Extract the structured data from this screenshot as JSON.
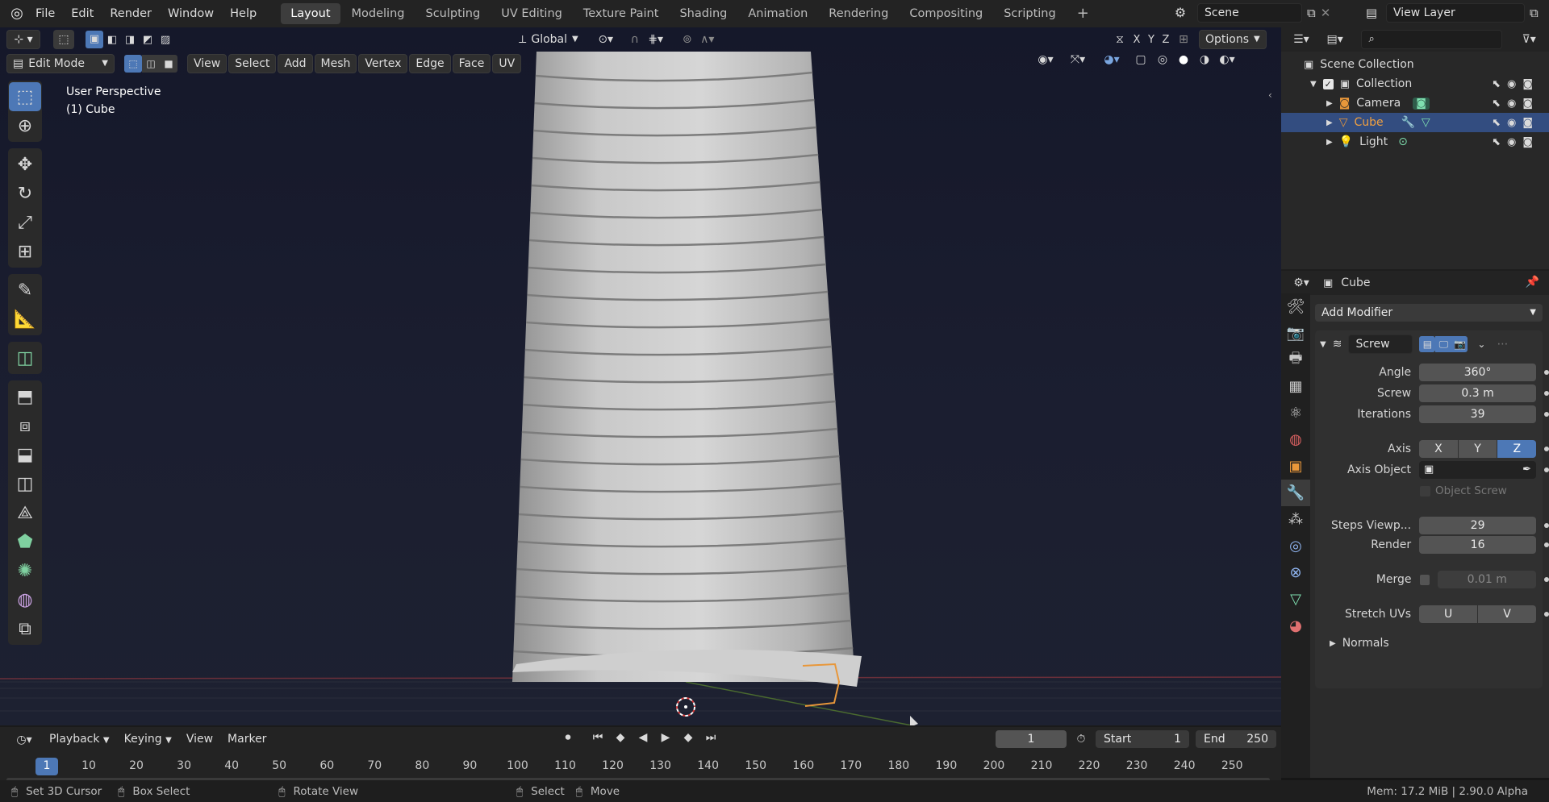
{
  "topbar": {
    "menus": [
      "File",
      "Edit",
      "Render",
      "Window",
      "Help"
    ],
    "workspaces": [
      "Layout",
      "Modeling",
      "Sculpting",
      "UV Editing",
      "Texture Paint",
      "Shading",
      "Animation",
      "Rendering",
      "Compositing",
      "Scripting"
    ],
    "active_workspace": "Layout",
    "add_tab_label": "+",
    "scene_name": "Scene",
    "view_layer": "View Layer"
  },
  "viewport": {
    "mode": "Edit Mode",
    "menus": [
      "View",
      "Select",
      "Add",
      "Mesh",
      "Vertex",
      "Edge",
      "Face",
      "UV"
    ],
    "orientation": "Global",
    "axes": [
      "X",
      "Y",
      "Z"
    ],
    "options_label": "Options",
    "overlay_title": "User Perspective",
    "overlay_object": "(1) Cube"
  },
  "outliner": {
    "root": "Scene Collection",
    "collection": "Collection",
    "items": [
      {
        "name": "Camera",
        "selected": false
      },
      {
        "name": "Cube",
        "selected": true
      },
      {
        "name": "Light",
        "selected": false
      }
    ]
  },
  "properties": {
    "object_name": "Cube",
    "add_modifier": "Add Modifier",
    "modifier_name": "Screw",
    "angle_label": "Angle",
    "angle": "360°",
    "screw_label": "Screw",
    "screw": "0.3 m",
    "iterations_label": "Iterations",
    "iterations": "39",
    "axis_label": "Axis",
    "axis_options": [
      "X",
      "Y",
      "Z"
    ],
    "axis_selected": "Z",
    "axis_object_label": "Axis Object",
    "object_screw_label": "Object Screw",
    "steps_viewport_label": "Steps Viewp...",
    "steps_viewport": "29",
    "render_label": "Render",
    "render_steps": "16",
    "merge_label": "Merge",
    "merge_value": "0.01 m",
    "stretch_uvs_label": "Stretch UVs",
    "stretch_u": "U",
    "stretch_v": "V",
    "normals_label": "Normals"
  },
  "timeline": {
    "menus": [
      "Playback",
      "Keying",
      "View",
      "Marker"
    ],
    "current_frame": "1",
    "start_label": "Start",
    "start": "1",
    "end_label": "End",
    "end": "250",
    "ticks": [
      "1",
      "10",
      "20",
      "30",
      "40",
      "50",
      "60",
      "70",
      "80",
      "90",
      "100",
      "110",
      "120",
      "130",
      "140",
      "150",
      "160",
      "170",
      "180",
      "190",
      "200",
      "210",
      "220",
      "230",
      "240",
      "250"
    ]
  },
  "statusbar": {
    "set_cursor": "Set 3D Cursor",
    "box_select": "Box Select",
    "rotate_view": "Rotate View",
    "select": "Select",
    "move": "Move",
    "memory": "Mem: 17.2 MiB | 2.90.0 Alpha"
  },
  "colors": {
    "accent": "#4d78b6",
    "selected_row": "#334d80",
    "cube_orange": "#e8973a"
  }
}
